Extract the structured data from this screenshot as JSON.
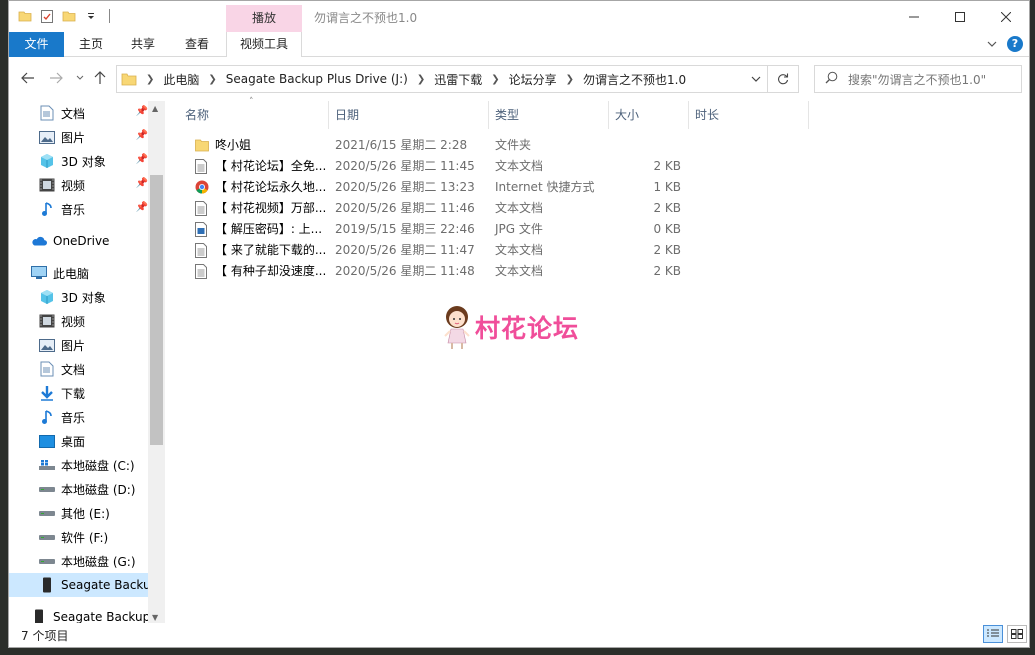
{
  "window": {
    "title": "勿谓言之不预也1.0",
    "context_tab_group": "播放"
  },
  "ribbon": {
    "tabs": [
      "文件",
      "主页",
      "共享",
      "查看",
      "视频工具"
    ]
  },
  "address": {
    "crumbs": [
      "此电脑",
      "Seagate Backup Plus Drive (J:)",
      "迅雷下载",
      "论坛分享",
      "勿谓言之不预也1.0"
    ]
  },
  "search": {
    "placeholder": "搜索\"勿谓言之不预也1.0\""
  },
  "nav": {
    "quick_access": [
      {
        "label": "文档",
        "icon": "documents-icon"
      },
      {
        "label": "图片",
        "icon": "pictures-icon"
      },
      {
        "label": "3D 对象",
        "icon": "3d-objects-icon"
      },
      {
        "label": "视频",
        "icon": "videos-icon"
      },
      {
        "label": "音乐",
        "icon": "music-icon"
      }
    ],
    "onedrive": "OneDrive",
    "this_pc": "此电脑",
    "this_pc_items": [
      {
        "label": "3D 对象",
        "icon": "3d-objects-icon"
      },
      {
        "label": "视频",
        "icon": "videos-icon"
      },
      {
        "label": "图片",
        "icon": "pictures-icon"
      },
      {
        "label": "文档",
        "icon": "documents-icon"
      },
      {
        "label": "下载",
        "icon": "downloads-icon"
      },
      {
        "label": "音乐",
        "icon": "music-icon"
      },
      {
        "label": "桌面",
        "icon": "desktop-icon"
      },
      {
        "label": "本地磁盘 (C:)",
        "icon": "windows-drive-icon"
      },
      {
        "label": "本地磁盘 (D:)",
        "icon": "drive-icon"
      },
      {
        "label": "其他 (E:)",
        "icon": "drive-icon"
      },
      {
        "label": "软件 (F:)",
        "icon": "drive-icon"
      },
      {
        "label": "本地磁盘 (G:)",
        "icon": "drive-icon"
      },
      {
        "label": "Seagate Backu",
        "icon": "external-drive-icon"
      }
    ],
    "bottom_item": "Seagate Backup"
  },
  "columns": [
    "名称",
    "日期",
    "类型",
    "大小",
    "时长"
  ],
  "files": [
    {
      "name": "咚小姐",
      "date": "2021/6/15  星期二 2:28",
      "type": "文件夹",
      "size": "",
      "icon": "folder-icon"
    },
    {
      "name": "【 村花论坛】全免...",
      "date": "2020/5/26  星期二 11:45",
      "type": "文本文档",
      "size": "2 KB",
      "icon": "text-file-icon"
    },
    {
      "name": "【 村花论坛永久地...",
      "date": "2020/5/26  星期二 13:23",
      "type": "Internet 快捷方式",
      "size": "1 KB",
      "icon": "chrome-shortcut-icon"
    },
    {
      "name": "【 村花视频】万部...",
      "date": "2020/5/26  星期二 11:46",
      "type": "文本文档",
      "size": "2 KB",
      "icon": "text-file-icon"
    },
    {
      "name": "【 解压密码】: 上...",
      "date": "2019/5/15  星期三 22:46",
      "type": "JPG 文件",
      "size": "0 KB",
      "icon": "image-file-icon"
    },
    {
      "name": "【 来了就能下载的...",
      "date": "2020/5/26  星期二 11:47",
      "type": "文本文档",
      "size": "2 KB",
      "icon": "text-file-icon"
    },
    {
      "name": "【 有种子却没速度...",
      "date": "2020/5/26  星期二 11:48",
      "type": "文本文档",
      "size": "2 KB",
      "icon": "text-file-icon"
    }
  ],
  "watermark": "村花论坛",
  "status": {
    "count": "7 个项目"
  },
  "colors": {
    "file_tab": "#1979ca",
    "context_tab": "#f9d5e6",
    "selection": "#cce8ff",
    "watermark": "#f04e9a"
  }
}
